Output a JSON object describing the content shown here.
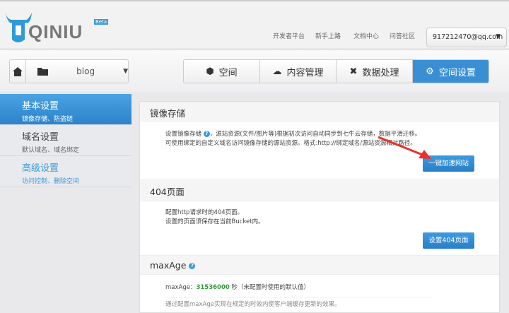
{
  "header": {
    "logo": "QINIU",
    "beta": "Beta",
    "links": [
      "开发者平台",
      "新手上路",
      "文档中心",
      "问答社区"
    ],
    "account": "917212470@qq.com"
  },
  "nav": {
    "bucket": "blog",
    "tabs": [
      {
        "label": "空间",
        "icon": "box-icon"
      },
      {
        "label": "内容管理",
        "icon": "cloud-upload-icon"
      },
      {
        "label": "数据处理",
        "icon": "tools-icon"
      },
      {
        "label": "空间设置",
        "icon": "gear-icon",
        "active": true
      }
    ]
  },
  "sidebar": {
    "items": [
      {
        "title": "基本设置",
        "sub": "镜像存储、防盗链"
      },
      {
        "title": "域名设置",
        "sub": "默认域名、域名绑定"
      },
      {
        "title": "高级设置",
        "sub": "访问控制、删除空间"
      }
    ]
  },
  "sections": {
    "mirror": {
      "title": "镜像存储",
      "line1a": "设置镜像存储",
      "line1b": "，源站资源(文件/图片等)根据初次访问自动同步到七牛云存储，数据平滑迁移。",
      "line2": "可使用绑定的自定义域名访问镜像存储的源站资源。格式:http://绑定域名/源站资源相对路径。",
      "button": "一键加速网站"
    },
    "page404": {
      "title": "404页面",
      "line1": "配置http请求时的404页面。",
      "line2": "设置的页面须保存在当前Bucket内。",
      "button": "设置404页面"
    },
    "maxage": {
      "title": "maxAge",
      "label": "maxAge：",
      "value": "31536000",
      "unit": "秒（未配置时使用的默认值）",
      "note": "通过配置maxAge实现在规定的时效内使客户端缓存更新的效果。"
    }
  },
  "colors": {
    "accent": "#3a8fd4",
    "arrow": "#e8322e",
    "value": "#2e9a3a"
  }
}
